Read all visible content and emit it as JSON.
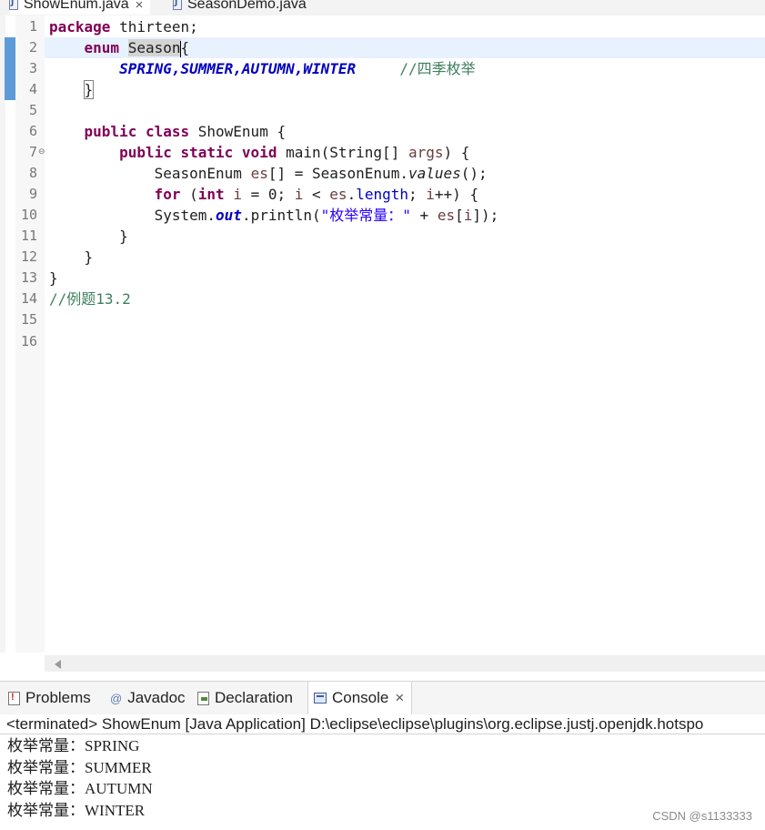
{
  "editor_tabs": [
    {
      "name": "ShowEnum.java",
      "active": true,
      "closable": true
    },
    {
      "name": "SeasonDemo.java",
      "active": false,
      "closable": false
    }
  ],
  "code": {
    "lines": [
      "1",
      "2",
      "3",
      "4",
      "5",
      "6",
      "7",
      "8",
      "9",
      "10",
      "11",
      "12",
      "13",
      "14",
      "15",
      "16"
    ],
    "l1_kw": "package",
    "l1_rest": " thirteen;",
    "l2_kw": "enum",
    "l2_name": "Season",
    "l2_brace": "{",
    "l3_consts": "SPRING,SUMMER,AUTUMN,WINTER",
    "l3_comment": "//四季枚举",
    "l4_brace": "}",
    "l6_kw": "public class",
    "l6_rest": " ShowEnum {",
    "l7_kw": "public static void",
    "l7_a": " main(String[] ",
    "l7_var": "args",
    "l7_b": ") {",
    "l8_a": "SeasonEnum ",
    "l8_var": "es",
    "l8_b": "[] = SeasonEnum.",
    "l8_method": "values",
    "l8_c": "();",
    "l9_kw": "for",
    "l9_a": " (",
    "l9_kw2": "int",
    "l9_b": " ",
    "l9_var1": "i",
    "l9_c": " = 0; ",
    "l9_var2": "i",
    "l9_d": " < ",
    "l9_var3": "es",
    "l9_e": ".",
    "l9_field": "length",
    "l9_f": "; ",
    "l9_var4": "i",
    "l9_g": "++) {",
    "l10_a": "System.",
    "l10_out": "out",
    "l10_b": ".println(",
    "l10_str": "\"枚举常量：\"",
    "l10_c": " + ",
    "l10_var": "es",
    "l10_d": "[",
    "l10_var2": "i",
    "l10_e": "]);",
    "l11": "}",
    "l12": "}",
    "l13": "}",
    "l14_comment": "//例题13.2"
  },
  "panel_tabs": [
    {
      "label": "Problems",
      "icon": "problems-icon"
    },
    {
      "label": "Javadoc",
      "icon": "javadoc-icon"
    },
    {
      "label": "Declaration",
      "icon": "declaration-icon"
    },
    {
      "label": "Console",
      "icon": "console-icon",
      "active": true
    }
  ],
  "console": {
    "status": "<terminated> ShowEnum [Java Application] D:\\eclipse\\eclipse\\plugins\\org.eclipse.justj.openjdk.hotspo",
    "output": [
      "枚举常量：SPRING",
      "枚举常量：SUMMER",
      "枚举常量：AUTUMN",
      "枚举常量：WINTER"
    ]
  },
  "watermark": "CSDN @s1133333",
  "colors": {
    "keyword": "#7f0055",
    "constant": "#0000c0",
    "string": "#2a00ff",
    "comment": "#3f7f5f",
    "change_bar": "#5d9bd8"
  }
}
